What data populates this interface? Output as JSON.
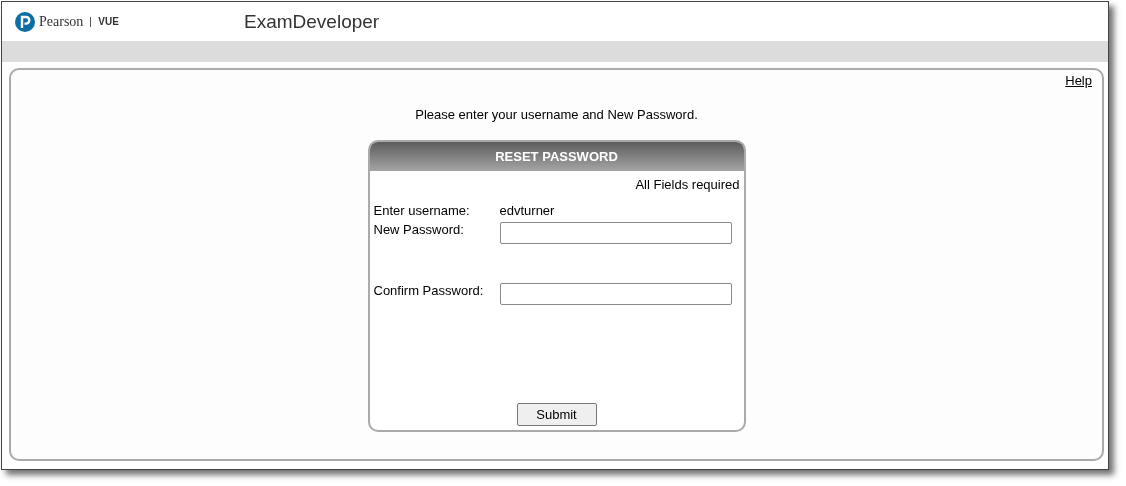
{
  "header": {
    "brand": "Pearson",
    "brand_sub": "VUE",
    "app_title": "ExamDeveloper"
  },
  "help_link": "Help",
  "instruction": "Please enter your username and New Password.",
  "form": {
    "title": "RESET PASSWORD",
    "note": "All Fields required",
    "fields": [
      {
        "kind": "text",
        "label": "Enter username:",
        "value": "edvturner"
      },
      {
        "kind": "input",
        "label": "New Password:"
      },
      {
        "kind": "input",
        "label": "Confirm Password:"
      }
    ],
    "submit": "Submit"
  }
}
